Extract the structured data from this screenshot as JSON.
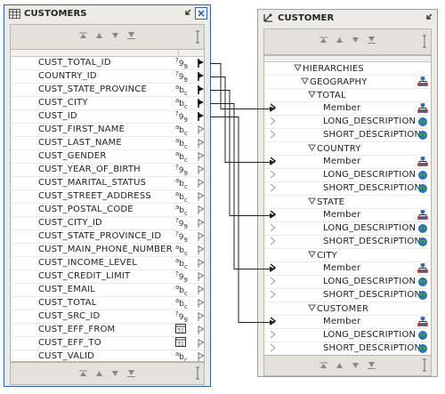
{
  "left_entity": {
    "title": "CUSTOMERS",
    "columns": [
      {
        "name": "CUST_TOTAL_ID",
        "type": "number",
        "key": "mapped"
      },
      {
        "name": "COUNTRY_ID",
        "type": "number",
        "key": "mapped"
      },
      {
        "name": "CUST_STATE_PROVINCE",
        "type": "string",
        "key": "mapped"
      },
      {
        "name": "CUST_CITY",
        "type": "string",
        "key": "mapped"
      },
      {
        "name": "CUST_ID",
        "type": "number",
        "key": "mapped"
      },
      {
        "name": "CUST_FIRST_NAME",
        "type": "string",
        "key": "unmapped"
      },
      {
        "name": "CUST_LAST_NAME",
        "type": "string",
        "key": "unmapped"
      },
      {
        "name": "CUST_GENDER",
        "type": "string",
        "key": "unmapped"
      },
      {
        "name": "CUST_YEAR_OF_BIRTH",
        "type": "number",
        "key": "unmapped"
      },
      {
        "name": "CUST_MARITAL_STATUS",
        "type": "string",
        "key": "unmapped"
      },
      {
        "name": "CUST_STREET_ADDRESS",
        "type": "string",
        "key": "unmapped"
      },
      {
        "name": "CUST_POSTAL_CODE",
        "type": "string",
        "key": "unmapped"
      },
      {
        "name": "CUST_CITY_ID",
        "type": "number",
        "key": "unmapped"
      },
      {
        "name": "CUST_STATE_PROVINCE_ID",
        "type": "number",
        "key": "unmapped"
      },
      {
        "name": "CUST_MAIN_PHONE_NUMBER",
        "type": "string",
        "key": "unmapped"
      },
      {
        "name": "CUST_INCOME_LEVEL",
        "type": "string",
        "key": "unmapped"
      },
      {
        "name": "CUST_CREDIT_LIMIT",
        "type": "number",
        "key": "unmapped"
      },
      {
        "name": "CUST_EMAIL",
        "type": "string",
        "key": "unmapped"
      },
      {
        "name": "CUST_TOTAL",
        "type": "string",
        "key": "unmapped"
      },
      {
        "name": "CUST_SRC_ID",
        "type": "number",
        "key": "unmapped"
      },
      {
        "name": "CUST_EFF_FROM",
        "type": "date",
        "key": "unmapped"
      },
      {
        "name": "CUST_EFF_TO",
        "type": "date",
        "key": "unmapped"
      },
      {
        "name": "CUST_VALID",
        "type": "string",
        "key": "unmapped"
      }
    ]
  },
  "right_entity": {
    "title": "CUSTOMER",
    "rows": [
      {
        "kind": "group",
        "level": 0,
        "label": "HIERARCHIES",
        "arrow": false,
        "icon": "none"
      },
      {
        "kind": "group",
        "level": 1,
        "label": "GEOGRAPHY",
        "arrow": false,
        "icon": "hierarchy-icon"
      },
      {
        "kind": "group",
        "level": 2,
        "label": "TOTAL",
        "arrow": false,
        "icon": "none"
      },
      {
        "kind": "attr",
        "level": 3,
        "label": "Member",
        "arrow": true,
        "icon": "member-icon"
      },
      {
        "kind": "attr",
        "level": 3,
        "label": "LONG_DESCRIPTION",
        "arrow": false,
        "icon": "globe-icon"
      },
      {
        "kind": "attr",
        "level": 3,
        "label": "SHORT_DESCRIPTION",
        "arrow": false,
        "icon": "globe-icon"
      },
      {
        "kind": "group",
        "level": 2,
        "label": "COUNTRY",
        "arrow": false,
        "icon": "none"
      },
      {
        "kind": "attr",
        "level": 3,
        "label": "Member",
        "arrow": true,
        "icon": "member-icon"
      },
      {
        "kind": "attr",
        "level": 3,
        "label": "LONG_DESCRIPTION",
        "arrow": false,
        "icon": "globe-icon"
      },
      {
        "kind": "attr",
        "level": 3,
        "label": "SHORT_DESCRIPTION",
        "arrow": false,
        "icon": "globe-icon"
      },
      {
        "kind": "group",
        "level": 2,
        "label": "STATE",
        "arrow": false,
        "icon": "none"
      },
      {
        "kind": "attr",
        "level": 3,
        "label": "Member",
        "arrow": true,
        "icon": "member-icon"
      },
      {
        "kind": "attr",
        "level": 3,
        "label": "LONG_DESCRIPTION",
        "arrow": false,
        "icon": "globe-icon"
      },
      {
        "kind": "attr",
        "level": 3,
        "label": "SHORT_DESCRIPTION",
        "arrow": false,
        "icon": "globe-icon"
      },
      {
        "kind": "group",
        "level": 2,
        "label": "CITY",
        "arrow": false,
        "icon": "none"
      },
      {
        "kind": "attr",
        "level": 3,
        "label": "Member",
        "arrow": true,
        "icon": "member-icon"
      },
      {
        "kind": "attr",
        "level": 3,
        "label": "LONG_DESCRIPTION",
        "arrow": false,
        "icon": "globe-icon"
      },
      {
        "kind": "attr",
        "level": 3,
        "label": "SHORT_DESCRIPTION",
        "arrow": false,
        "icon": "globe-icon"
      },
      {
        "kind": "group",
        "level": 2,
        "label": "CUSTOMER",
        "arrow": false,
        "icon": "none"
      },
      {
        "kind": "attr",
        "level": 3,
        "label": "Member",
        "arrow": true,
        "icon": "member-icon"
      },
      {
        "kind": "attr",
        "level": 3,
        "label": "LONG_DESCRIPTION",
        "arrow": false,
        "icon": "globe-icon"
      },
      {
        "kind": "attr",
        "level": 3,
        "label": "SHORT_DESCRIPTION",
        "arrow": false,
        "icon": "globe-icon"
      }
    ]
  },
  "mappings": [
    {
      "from": "CUST_TOTAL_ID",
      "to": "TOTAL"
    },
    {
      "from": "COUNTRY_ID",
      "to": "COUNTRY"
    },
    {
      "from": "CUST_STATE_PROVINCE",
      "to": "STATE"
    },
    {
      "from": "CUST_CITY",
      "to": "CITY"
    },
    {
      "from": "CUST_ID",
      "to": "CUSTOMER"
    }
  ],
  "type_glyphs": {
    "number": "?9",
    "string": "abc",
    "date": "31"
  },
  "colors": {
    "left_border": "#2d62b8",
    "link": "#222222",
    "panel_bg": "#ecebe6"
  }
}
